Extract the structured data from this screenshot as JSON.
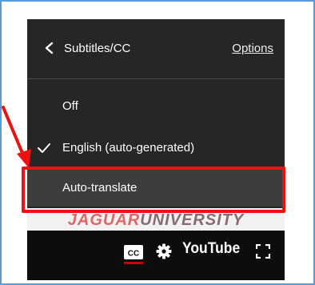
{
  "menu": {
    "title": "Subtitles/CC",
    "options_label": "Options",
    "back_icon": "chevron-left-icon",
    "items": [
      {
        "label": "Off",
        "selected": false
      },
      {
        "label": "English (auto-generated)",
        "selected": true
      },
      {
        "label": "Auto-translate",
        "selected": false,
        "highlighted": true
      }
    ]
  },
  "video": {
    "watermark_part1": "JAGUAR",
    "watermark_part2": "UNIVERSITY"
  },
  "controls": {
    "cc_icon": "closed-captions-icon",
    "settings_icon": "gear-icon",
    "brand_label": "YouTube",
    "fullscreen_icon": "fullscreen-icon"
  },
  "annotation": {
    "arrow_color": "#ee1111",
    "box_color": "#ee1111"
  },
  "colors": {
    "menu_bg": "#262626",
    "selected_item_bg": "#3d3d3d",
    "frame_border": "#5b9bd5",
    "cc_underline": "#cc0000"
  }
}
